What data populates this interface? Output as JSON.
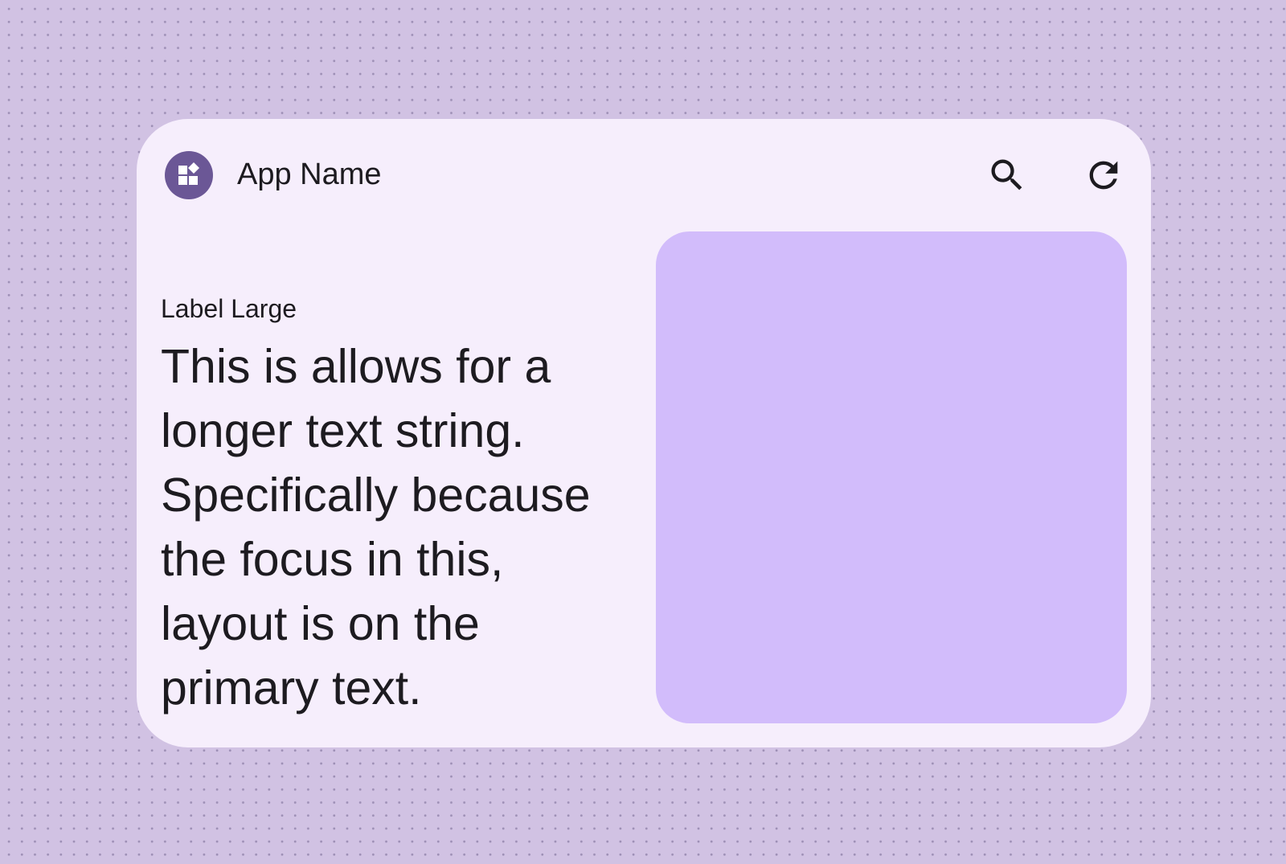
{
  "widget": {
    "app_name": "App Name",
    "app_icon": "widgets-icon",
    "actions": [
      {
        "icon": "search-icon"
      },
      {
        "icon": "refresh-icon"
      }
    ],
    "label": "Label Large",
    "primary_text": "This is allows for a longer text string. Specifically because the focus in this, layout is on the primary text."
  },
  "colors": {
    "background": "#D1C2E3",
    "widget_surface": "#F6EEFC",
    "app_icon_bg": "#6B5796",
    "image_placeholder": "#D2BCFB",
    "text": "#1D1B20"
  }
}
